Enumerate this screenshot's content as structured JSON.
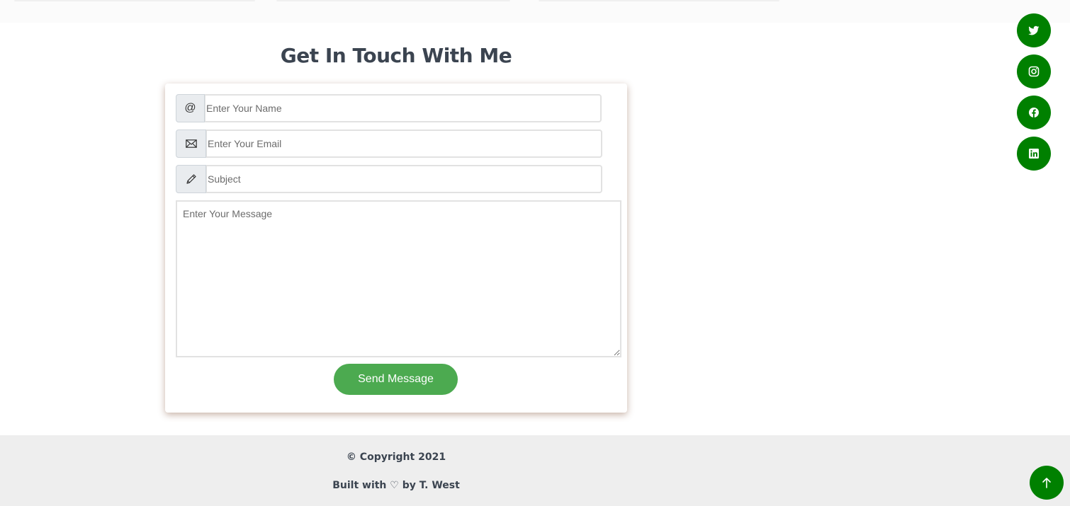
{
  "contact": {
    "title": "Get In Touch With Me",
    "name_placeholder": "Enter Your Name",
    "email_placeholder": "Enter Your Email",
    "subject_placeholder": "Subject",
    "message_placeholder": "Enter Your Message",
    "name_icon": "@",
    "send_label": "Send Message"
  },
  "icons": {
    "name": "at-icon",
    "email": "envelope-icon",
    "subject": "pencil-icon",
    "social": [
      "twitter-icon",
      "instagram-icon",
      "facebook-icon",
      "linkedin-icon"
    ],
    "to_top": "arrow-up-icon"
  },
  "footer": {
    "copyright": "© Copyright 2021",
    "built_with": "Built with ♡ by T. West"
  },
  "colors": {
    "accent": "#008000",
    "button": "#4caa50",
    "heading": "#3b4450",
    "footer_bg": "#eeeeee"
  }
}
